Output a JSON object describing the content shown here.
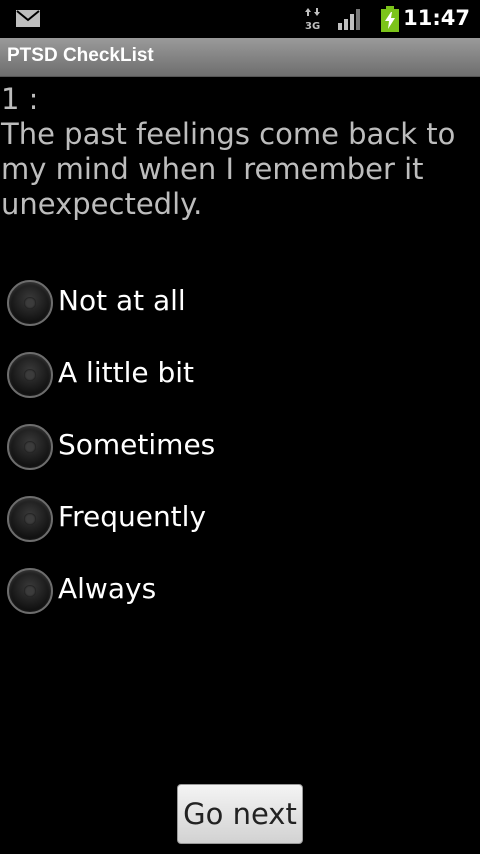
{
  "status_bar": {
    "time": "11:47",
    "network_label": "3G",
    "icons": [
      "mail-icon",
      "data-transfer-3g-icon",
      "signal-strength-icon",
      "battery-charging-icon"
    ]
  },
  "app": {
    "title": "PTSD CheckList"
  },
  "question": {
    "number_label": "1 :",
    "text": "The past feelings come back to my mind when I remember it unexpectedly."
  },
  "options": [
    {
      "label": "Not at all",
      "selected": false
    },
    {
      "label": "A little bit",
      "selected": false
    },
    {
      "label": "Sometimes",
      "selected": false
    },
    {
      "label": "Frequently",
      "selected": false
    },
    {
      "label": "Always",
      "selected": false
    }
  ],
  "actions": {
    "next_label": "Go next"
  },
  "colors": {
    "background": "#000000",
    "title_bar": "#808080",
    "question_text": "#bdbdbd",
    "option_text": "#ffffff",
    "battery_green": "#7cc41a"
  }
}
